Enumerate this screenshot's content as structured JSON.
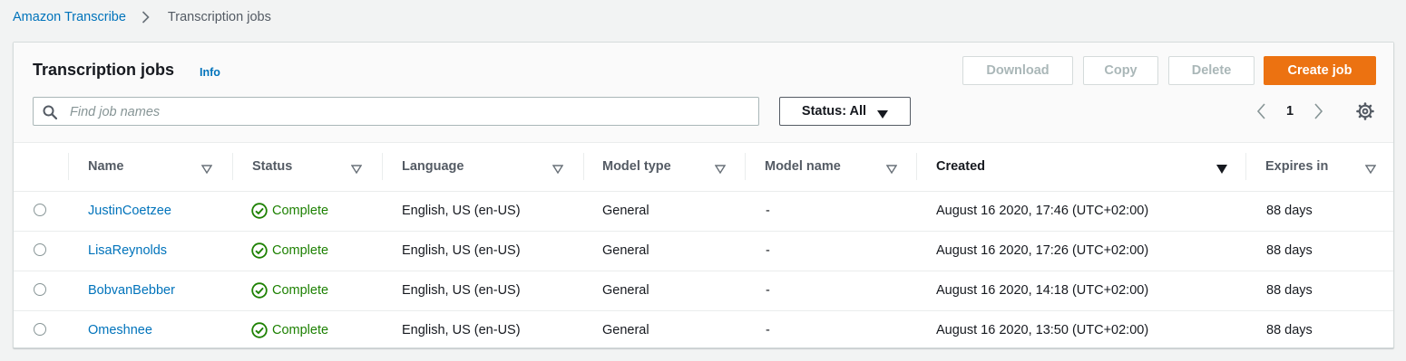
{
  "breadcrumb": {
    "root": "Amazon Transcribe",
    "current": "Transcription jobs"
  },
  "panel": {
    "title": "Transcription jobs",
    "info": "Info"
  },
  "actions": {
    "download": "Download",
    "copy": "Copy",
    "delete": "Delete",
    "create": "Create job"
  },
  "search": {
    "placeholder": "Find job names",
    "value": ""
  },
  "filter": {
    "label": "Status: All"
  },
  "pagination": {
    "current_page": "1"
  },
  "colors": {
    "accent": "#ec7211",
    "link": "#0073bb",
    "success": "#1d8102"
  },
  "table": {
    "columns": [
      "Name",
      "Status",
      "Language",
      "Model type",
      "Model name",
      "Created",
      "Expires in"
    ],
    "sorted_column": "Created",
    "rows": [
      {
        "name": "JustinCoetzee",
        "status": "Complete",
        "language": "English, US (en-US)",
        "model_type": "General",
        "model_name": "-",
        "created": "August 16 2020, 17:46 (UTC+02:00)",
        "expires": "88 days"
      },
      {
        "name": "LisaReynolds",
        "status": "Complete",
        "language": "English, US (en-US)",
        "model_type": "General",
        "model_name": "-",
        "created": "August 16 2020, 17:26 (UTC+02:00)",
        "expires": "88 days"
      },
      {
        "name": "BobvanBebber",
        "status": "Complete",
        "language": "English, US (en-US)",
        "model_type": "General",
        "model_name": "-",
        "created": "August 16 2020, 14:18 (UTC+02:00)",
        "expires": "88 days"
      },
      {
        "name": "Omeshnee",
        "status": "Complete",
        "language": "English, US (en-US)",
        "model_type": "General",
        "model_name": "-",
        "created": "August 16 2020, 13:50 (UTC+02:00)",
        "expires": "88 days"
      }
    ]
  },
  "icons": {
    "search": "search-icon",
    "caret": "caret-down-icon",
    "prev": "chevron-left-icon",
    "next": "chevron-right-icon",
    "settings": "gear-icon",
    "status_ok": "check-circle-icon",
    "sort": "sort-caret-icon",
    "breadcrumb_sep": "chevron-right-icon"
  }
}
